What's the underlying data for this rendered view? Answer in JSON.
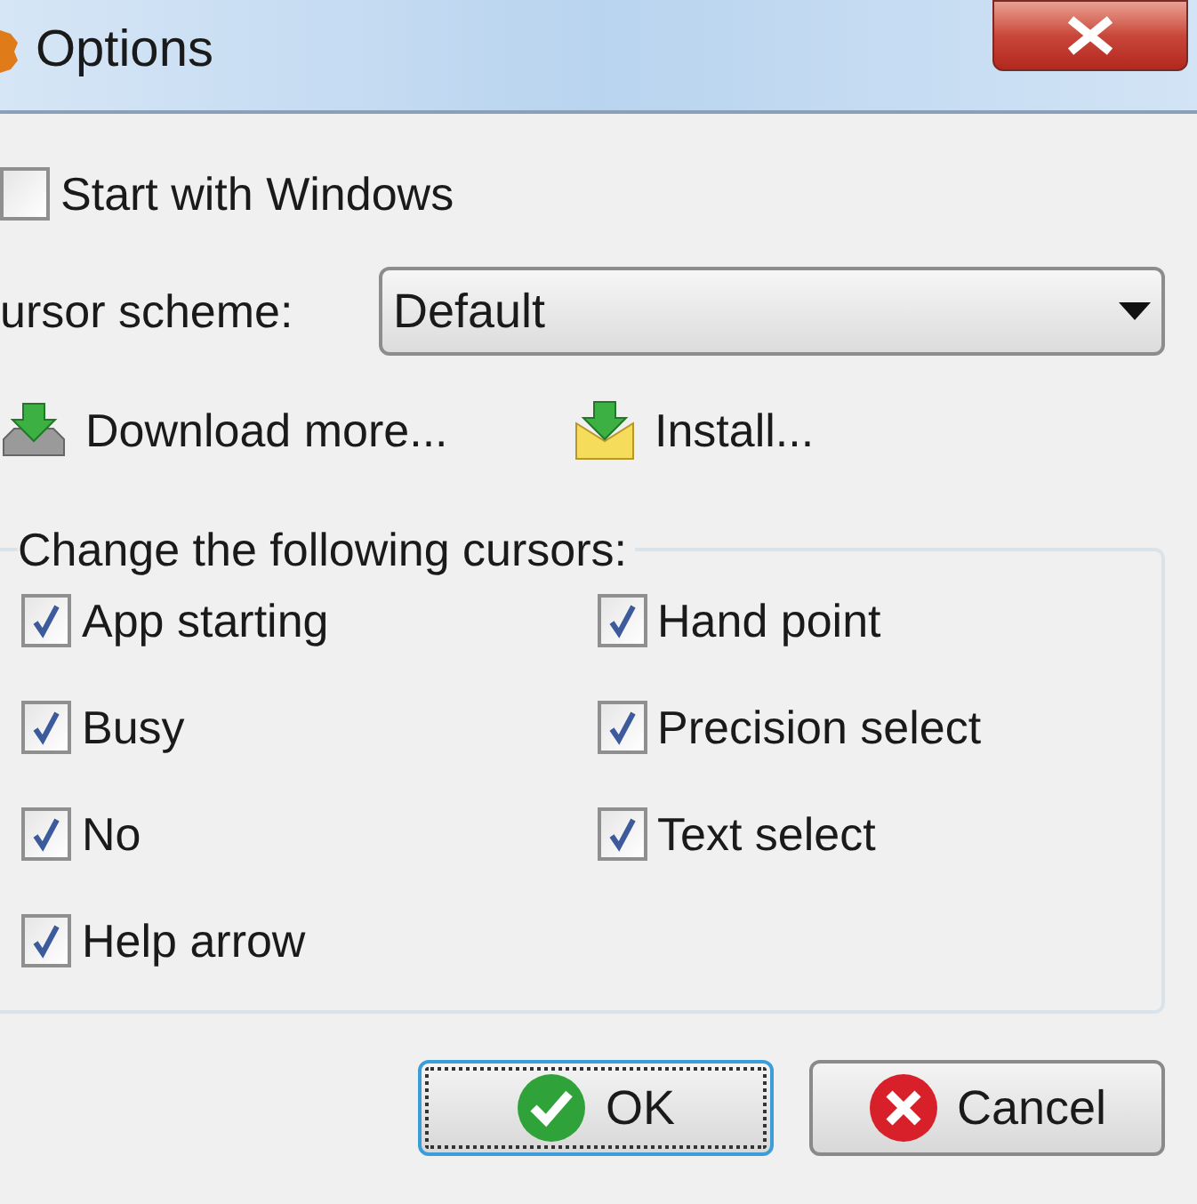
{
  "window": {
    "title": "Options"
  },
  "start_with_windows": {
    "label": "Start with Windows",
    "checked": false
  },
  "cursor_scheme": {
    "label": "ursor scheme:",
    "value": "Default"
  },
  "links": [
    {
      "kind": "download",
      "label": "Download more..."
    },
    {
      "kind": "install",
      "label": "Install..."
    }
  ],
  "group": {
    "title": "Change the following cursors:",
    "items": [
      {
        "label": "App starting",
        "checked": true
      },
      {
        "label": "Hand point",
        "checked": true
      },
      {
        "label": "Busy",
        "checked": true
      },
      {
        "label": "Precision select",
        "checked": true
      },
      {
        "label": "No",
        "checked": true
      },
      {
        "label": "Text select",
        "checked": true
      },
      {
        "label": "Help arrow",
        "checked": true
      }
    ]
  },
  "buttons": [
    {
      "kind": "ok",
      "label": "OK"
    },
    {
      "kind": "cancel",
      "label": "Cancel"
    }
  ]
}
